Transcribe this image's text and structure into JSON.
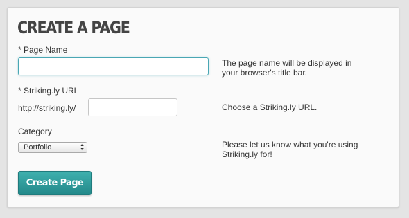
{
  "form": {
    "title": "CREATE A PAGE",
    "page_name": {
      "label": "* Page Name",
      "value": "",
      "help": "The page name will be displayed in your browser's title bar."
    },
    "url": {
      "label": "* Striking.ly URL",
      "prefix": "http://striking.ly/",
      "value": "",
      "help": "Choose a Striking.ly URL."
    },
    "category": {
      "label": "Category",
      "selected": "Portfolio",
      "help": "Please let us know what you're using Striking.ly for!"
    },
    "submit_label": "Create Page"
  },
  "colors": {
    "accent": "#4aa7b4",
    "button": "#2b9597"
  }
}
